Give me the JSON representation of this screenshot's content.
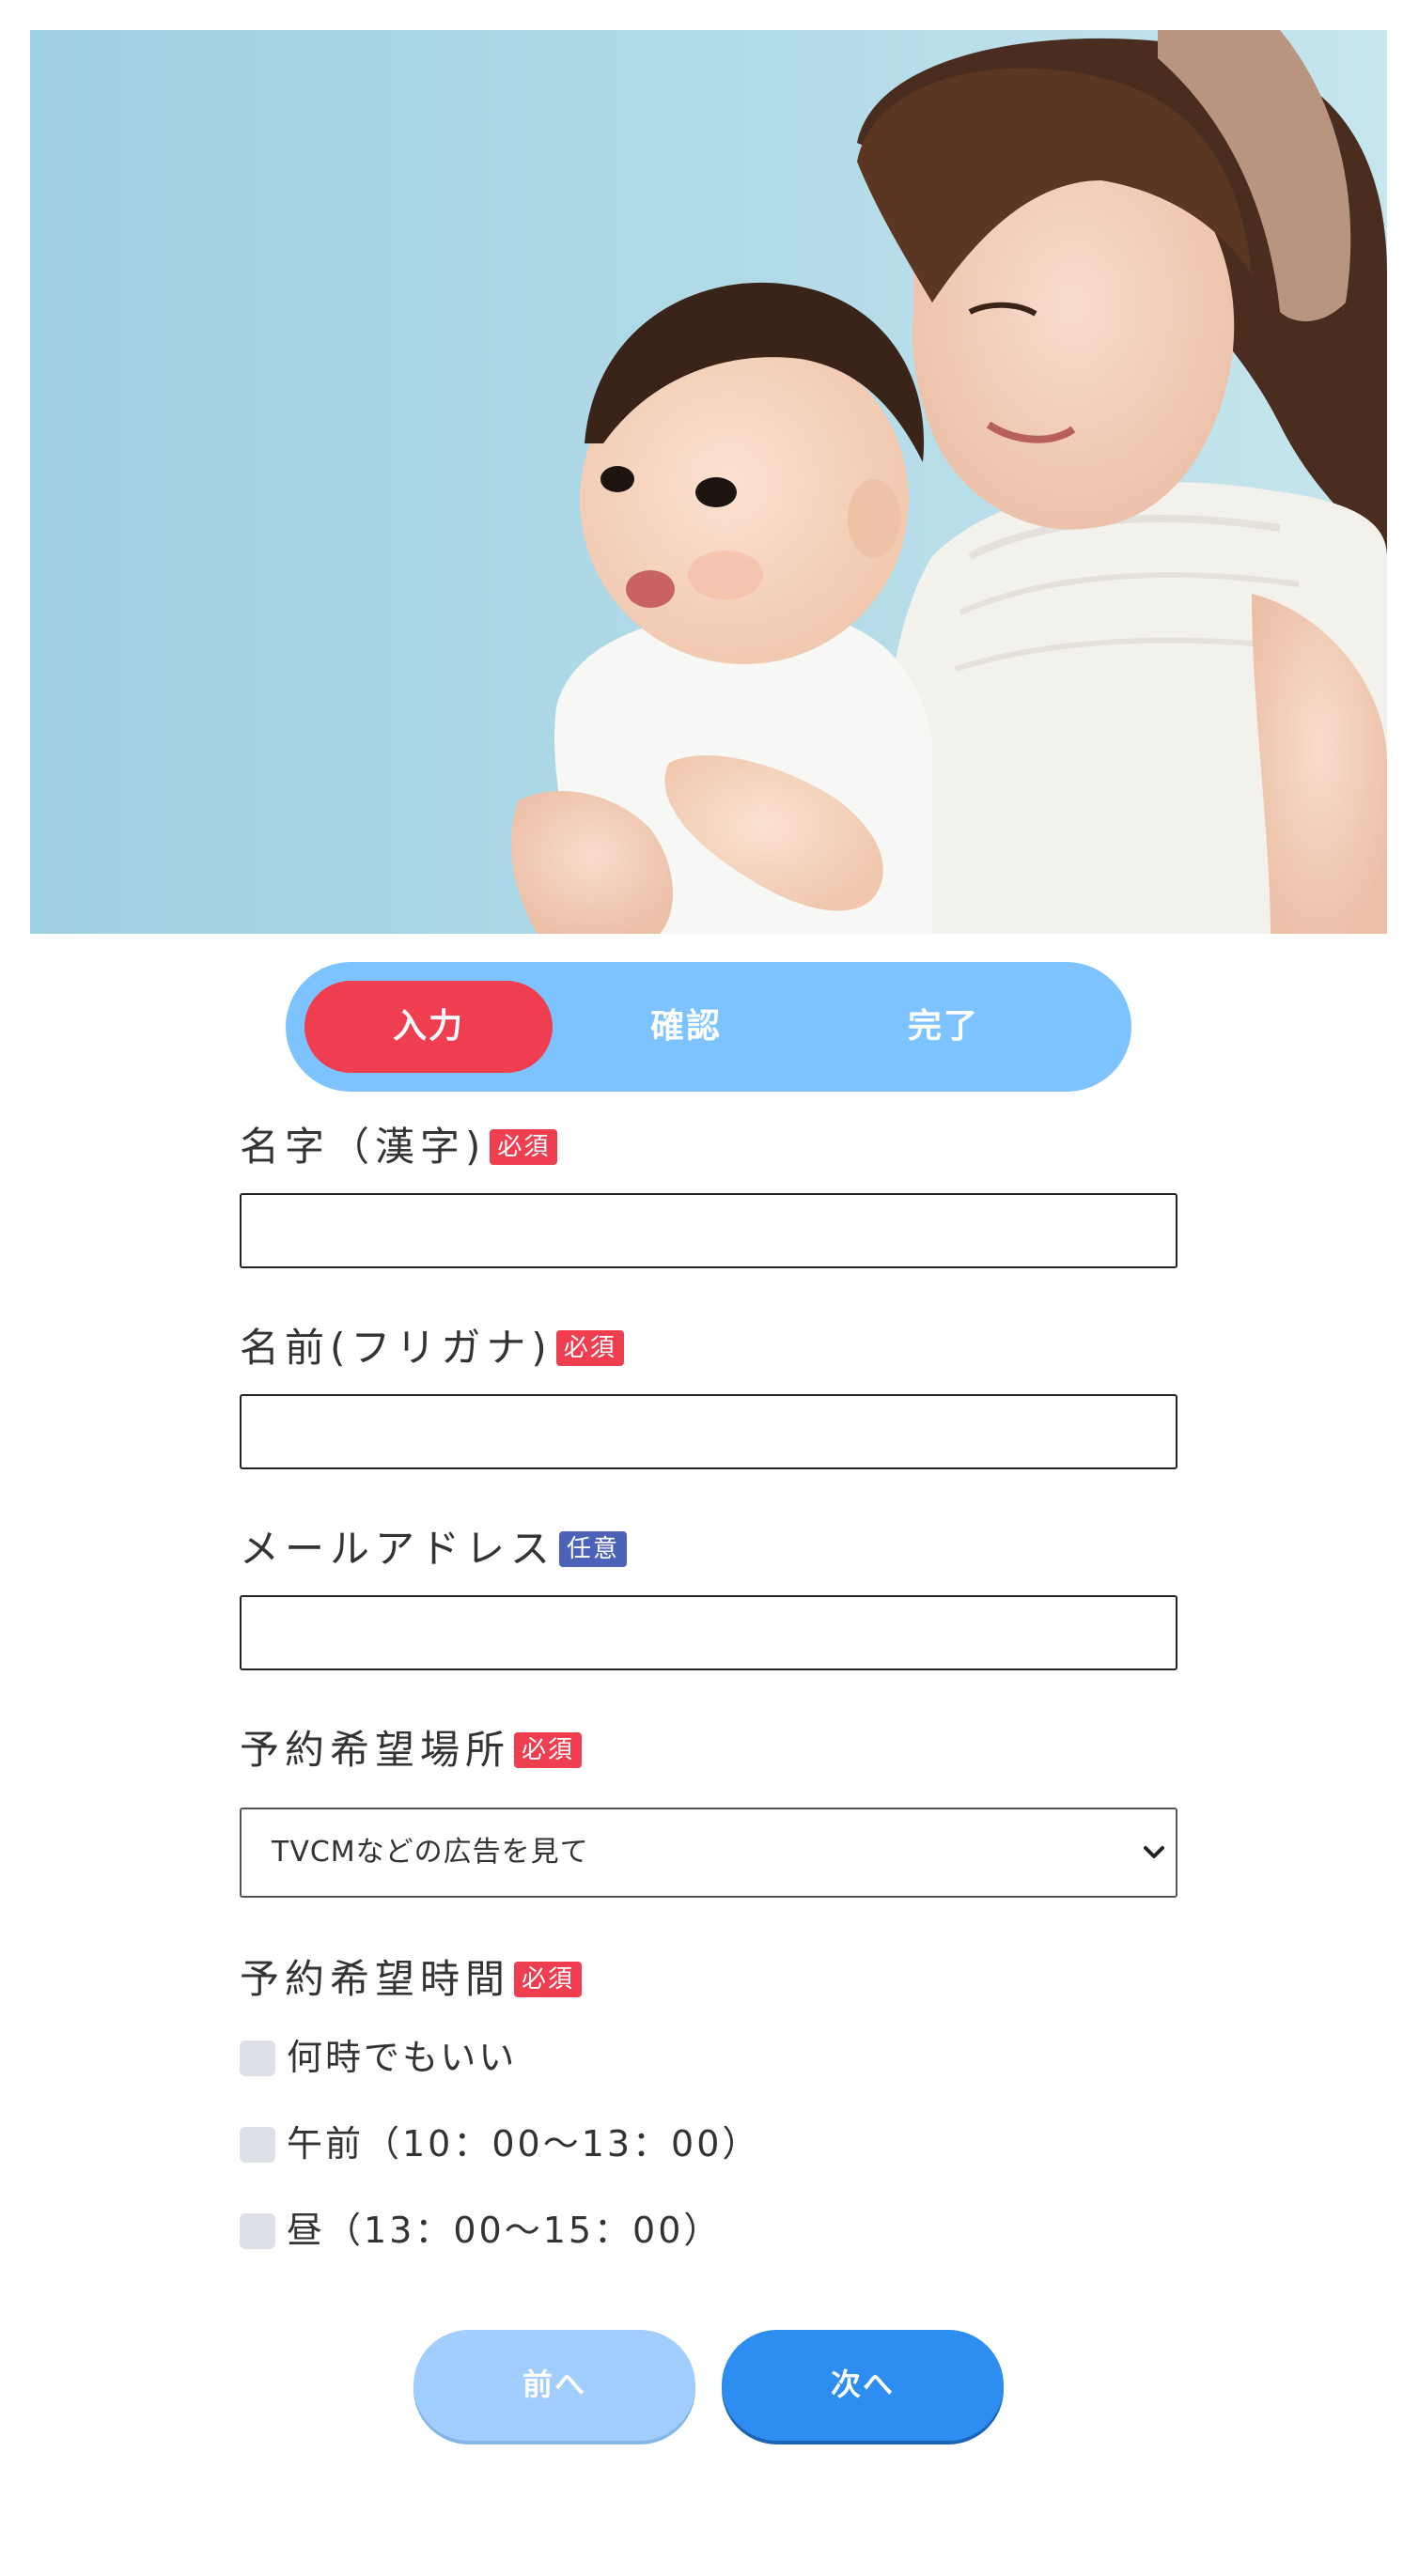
{
  "hero": {
    "image": "mother-holding-baby-photo"
  },
  "steps": [
    {
      "label": "入力",
      "active": true
    },
    {
      "label": "確認",
      "active": false
    },
    {
      "label": "完了",
      "active": false
    }
  ],
  "form": {
    "last_name": {
      "label": "名字（漢字)",
      "badge": "必須",
      "value": ""
    },
    "first_name_kana": {
      "label": "名前(フリガナ)",
      "badge": "必須",
      "value": ""
    },
    "email": {
      "label": "メールアドレス",
      "badge": "任意",
      "value": ""
    },
    "location": {
      "label": "予約希望場所",
      "badge": "必須",
      "selected": "TVCMなどの広告を見て"
    },
    "time": {
      "label": "予約希望時間",
      "badge": "必須",
      "options": [
        {
          "label": "何時でもいい",
          "checked": false
        },
        {
          "label": "午前（10：00〜13：00）",
          "checked": false
        },
        {
          "label": "昼（13：00〜15：00）",
          "checked": false
        }
      ]
    }
  },
  "buttons": {
    "prev": "前へ",
    "next": "次へ"
  },
  "colors": {
    "required_badge": "#ee3e4f",
    "optional_badge": "#4b62b8",
    "steps_bar": "#7cc3ff",
    "step_active": "#ee3e4f",
    "prev_button": "#a2cdff",
    "next_button": "#2e8df0"
  }
}
